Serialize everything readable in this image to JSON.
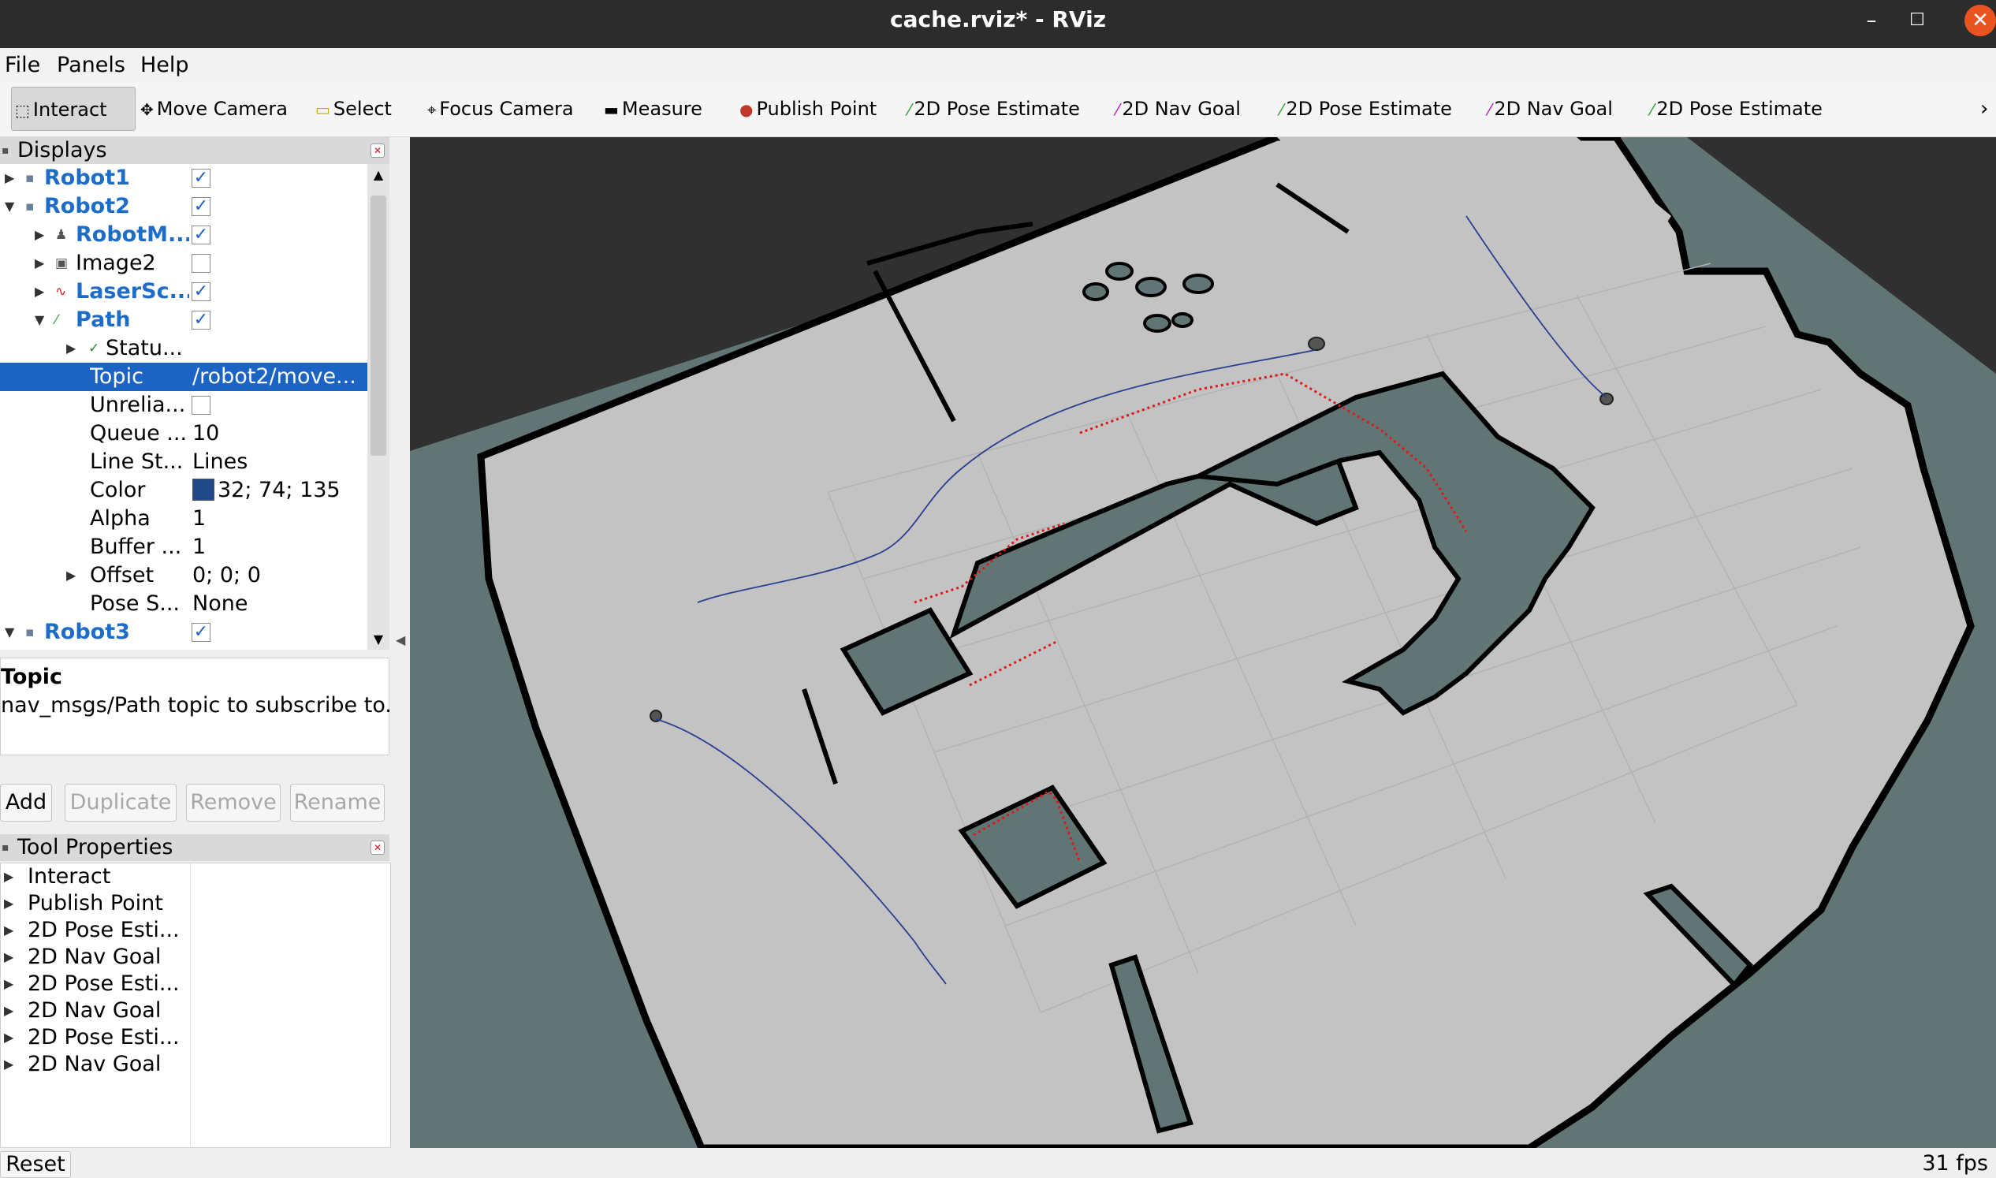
{
  "window": {
    "title": "cache.rviz* - RViz",
    "minimize": "–",
    "maximize": "☐",
    "close": "✕"
  },
  "menu": {
    "file": "File",
    "panels": "Panels",
    "help": "Help"
  },
  "toolbar": {
    "tools": [
      {
        "label": "Interact",
        "icon": "interact-icon"
      },
      {
        "label": "Move Camera",
        "icon": "move-camera-icon"
      },
      {
        "label": "Select",
        "icon": "select-icon"
      },
      {
        "label": "Focus Camera",
        "icon": "focus-camera-icon"
      },
      {
        "label": "Measure",
        "icon": "measure-icon"
      },
      {
        "label": "Publish Point",
        "icon": "publish-point-icon"
      },
      {
        "label": "2D Pose Estimate",
        "icon": "pose-estimate-icon"
      },
      {
        "label": "2D Nav Goal",
        "icon": "nav-goal-icon"
      },
      {
        "label": "2D Pose Estimate",
        "icon": "pose-estimate-icon"
      },
      {
        "label": "2D Nav Goal",
        "icon": "nav-goal-icon"
      },
      {
        "label": "2D Pose Estimate",
        "icon": "pose-estimate-icon"
      }
    ],
    "more": "›"
  },
  "displays": {
    "title": "Displays",
    "rows": [
      {
        "name": "Robot1"
      },
      {
        "name": "Robot2"
      },
      {
        "name": "RobotM..."
      },
      {
        "name": "Image2"
      },
      {
        "name": "LaserSc..."
      },
      {
        "name": "Path"
      },
      {
        "name": "Statu..."
      },
      {
        "name": "Topic",
        "value": "/robot2/move..."
      },
      {
        "name": "Unrelia..."
      },
      {
        "name": "Queue ...",
        "value": "10"
      },
      {
        "name": "Line St...",
        "value": "Lines"
      },
      {
        "name": "Color",
        "value": "32; 74; 135"
      },
      {
        "name": "Alpha",
        "value": "1"
      },
      {
        "name": "Buffer ...",
        "value": "1"
      },
      {
        "name": "Offset",
        "value": "0; 0; 0"
      },
      {
        "name": "Pose S...",
        "value": "None"
      },
      {
        "name": "Robot3"
      }
    ],
    "path_color": "#204a87"
  },
  "description": {
    "title": "Topic",
    "text": "nav_msgs/Path topic to subscribe to."
  },
  "buttons": {
    "add": "Add",
    "duplicate": "Duplicate",
    "remove": "Remove",
    "rename": "Rename"
  },
  "tool_properties": {
    "title": "Tool Properties",
    "items": [
      "Interact",
      "Publish Point",
      "2D Pose Esti...",
      "2D Nav Goal",
      "2D Pose Esti...",
      "2D Nav Goal",
      "2D Pose Esti...",
      "2D Nav Goal"
    ]
  },
  "status": {
    "reset": "Reset",
    "fps": "31 fps"
  },
  "colors": {
    "map_free": "#c3c3c3",
    "map_unknown": "#617575",
    "map_wall": "#000000",
    "background": "#303030",
    "laser": "#e01818",
    "path": "#2a3f8f"
  }
}
